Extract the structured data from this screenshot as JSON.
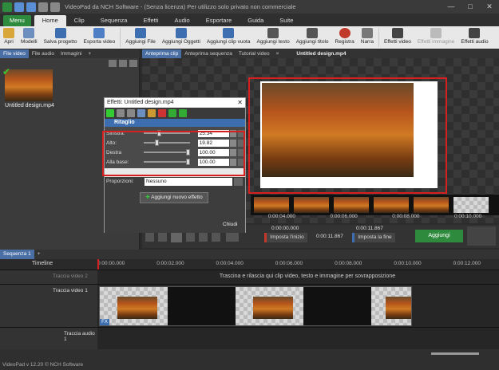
{
  "window": {
    "title": "VideoPad da NCH Software - (Senza licenza) Per utilizzo solo privato non commerciale"
  },
  "menu_label": "Menu",
  "tabs": [
    "Home",
    "Clip",
    "Sequenza",
    "Effetti",
    "Audio",
    "Esportare",
    "Guida",
    "Suite"
  ],
  "toolbar": [
    "Apri",
    "Modelli",
    "Salva progetto",
    "Esporta video",
    "Aggiungi File",
    "Aggiungi Oggetti",
    "Aggiungi clip vuota",
    "Aggiungi testo",
    "Aggiungi titolo",
    "Registra",
    "Narra",
    "Effetti video",
    "Effetti immagine",
    "Effetti audio"
  ],
  "left_tabs": [
    "File video",
    "File audio",
    "Immagini",
    "+"
  ],
  "media_item": "Untitled design.mp4",
  "preview_tabs": [
    "Anteprima clip",
    "Anteprima sequenza",
    "Tutorial video",
    "×"
  ],
  "preview_title": "Untitled design.mp4",
  "dialog": {
    "title": "Effetti: Untitled design.mp4",
    "section": "Ritaglio",
    "params": [
      {
        "label": "Sinistra:",
        "value": "25.34",
        "pos": 0.3
      },
      {
        "label": "Alto:",
        "value": "19.82",
        "pos": 0.25
      },
      {
        "label": "Destra",
        "value": "100.00",
        "pos": 0.95
      },
      {
        "label": "Alla base:",
        "value": "100.00",
        "pos": 0.95
      }
    ],
    "proportions_label": "Proporzioni:",
    "proportions_value": "Nessuno",
    "add_effect": "Aggiungi nuovo effetto",
    "close": "Chiudi"
  },
  "strip_times": [
    "0:00:04.000",
    "0:00:06.000",
    "0:00:08.000",
    "0:00:10.000"
  ],
  "time_start": "0:00:00.000",
  "time_dur": "0:00:11.867",
  "time_end": "0:00:11.867",
  "set_start": "Imposta l'inizio",
  "set_end": "Imposta la fine",
  "add_btn": "Aggiungi",
  "sequence_tab": "Sequenza 1",
  "timeline_label": "Timeline",
  "ruler_times": [
    "0:00:00.000",
    "0:00:02.000",
    "0:00:04.000",
    "0:00:06.000",
    "0:00:08.000",
    "0:00:10.000",
    "0:00:12.000"
  ],
  "track_overlay": "Traccia video 2",
  "overlay_hint": "Trascina e rilascia qui clip video, testo e immagine per sovrapposizione",
  "track_video1": "Traccia video 1",
  "track_audio1": "Traccia audio 1",
  "status": "VideoPad v 12.20 © NCH Software"
}
